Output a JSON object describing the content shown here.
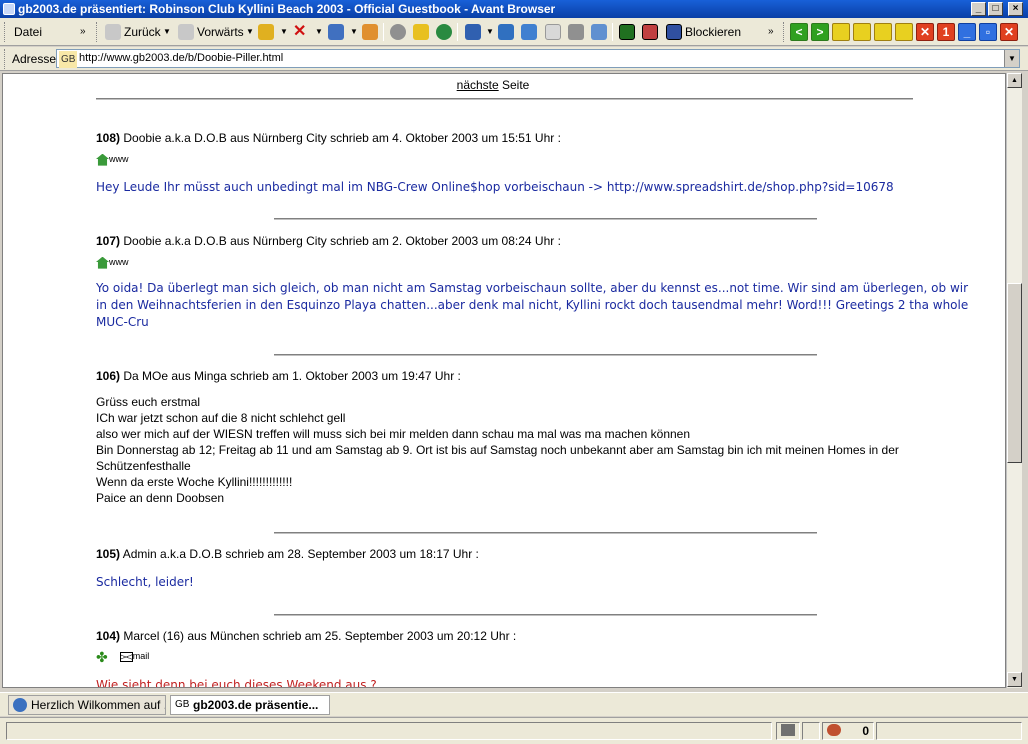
{
  "window": {
    "title": "gb2003.de präsentiert: Robinson Club Kyllini Beach 2003 - Official Guestbook - Avant Browser"
  },
  "toolbar": {
    "file_menu": "Datei",
    "back_label": "Zurück",
    "forward_label": "Vorwärts",
    "block_label": "Blockieren",
    "more": "»"
  },
  "address": {
    "label": "Adresse:",
    "badge": "GB",
    "url": "http://www.gb2003.de/b/Doobie-Piller.html"
  },
  "page": {
    "next_link": "nächste",
    "next_suffix": " Seite",
    "entries": [
      {
        "num": "108)",
        "header": " Doobie a.k.a D.O.B aus Nürnberg City schrieb am 4. Oktober 2003 um 15:51 Uhr :",
        "www": "www",
        "message": "Hey Leude Ihr müsst auch unbedingt mal im NBG-Crew Online$hop vorbeischaun -> http://www.spreadshirt.de/shop.php?sid=10678"
      },
      {
        "num": "107)",
        "header": " Doobie a.k.a D.O.B aus Nürnberg City schrieb am 2. Oktober 2003 um 08:24 Uhr :",
        "www": "www",
        "message": "Yo oida! Da überlegt man sich gleich, ob man nicht am Samstag vorbeischaun sollte, aber du kennst es...not time. Wir sind am überlegen, ob wir in den Weihnachtsferien in den Esquinzo Playa chatten...aber denk mal nicht, Kyllini rockt doch tausendmal mehr! Word!!! Greetings 2 tha whole MUC-Cru"
      },
      {
        "num": "106)",
        "header": " Da MOe aus Minga schrieb am 1. Oktober 2003 um 19:47 Uhr :",
        "lines": [
          "Grüss euch erstmal",
          "ICh war jetzt schon auf die 8 nicht schlehct gell",
          "also wer mich auf der WIESN treffen will muss sich bei mir melden dann schau ma mal was ma machen können",
          "Bin Donnerstag ab 12; Freitag ab 11 und am Samstag ab 9. Ort ist bis auf Samstag noch unbekannt aber am Samstag bin ich mit meinen Homes in der Schützenfesthalle",
          "Wenn da erste Woche Kyllini!!!!!!!!!!!!!",
          "Paice an denn Doobsen"
        ]
      },
      {
        "num": "105)",
        "header": " Admin a.k.a D.O.B schrieb am 28. September 2003 um 18:17 Uhr :",
        "message": "Schlecht, leider!"
      },
      {
        "num": "104)",
        "header": " Marcel (16) aus München schrieb am 25. September 2003 um 20:12 Uhr :",
        "mail": "mail",
        "message": "Wie sieht denn bei euch dieses Weekend aus ?"
      }
    ]
  },
  "tabs": [
    {
      "label": "Herzlich Wilkommen auf ..."
    },
    {
      "badge": "GB",
      "label": "gb2003.de präsentie..."
    }
  ],
  "status": {
    "count": "0"
  },
  "colors": {
    "title_bar": "#0a3fa6",
    "message_blue": "#1a2aa0",
    "message_red": "#c02020",
    "nav_green": "#2c9a1c"
  }
}
